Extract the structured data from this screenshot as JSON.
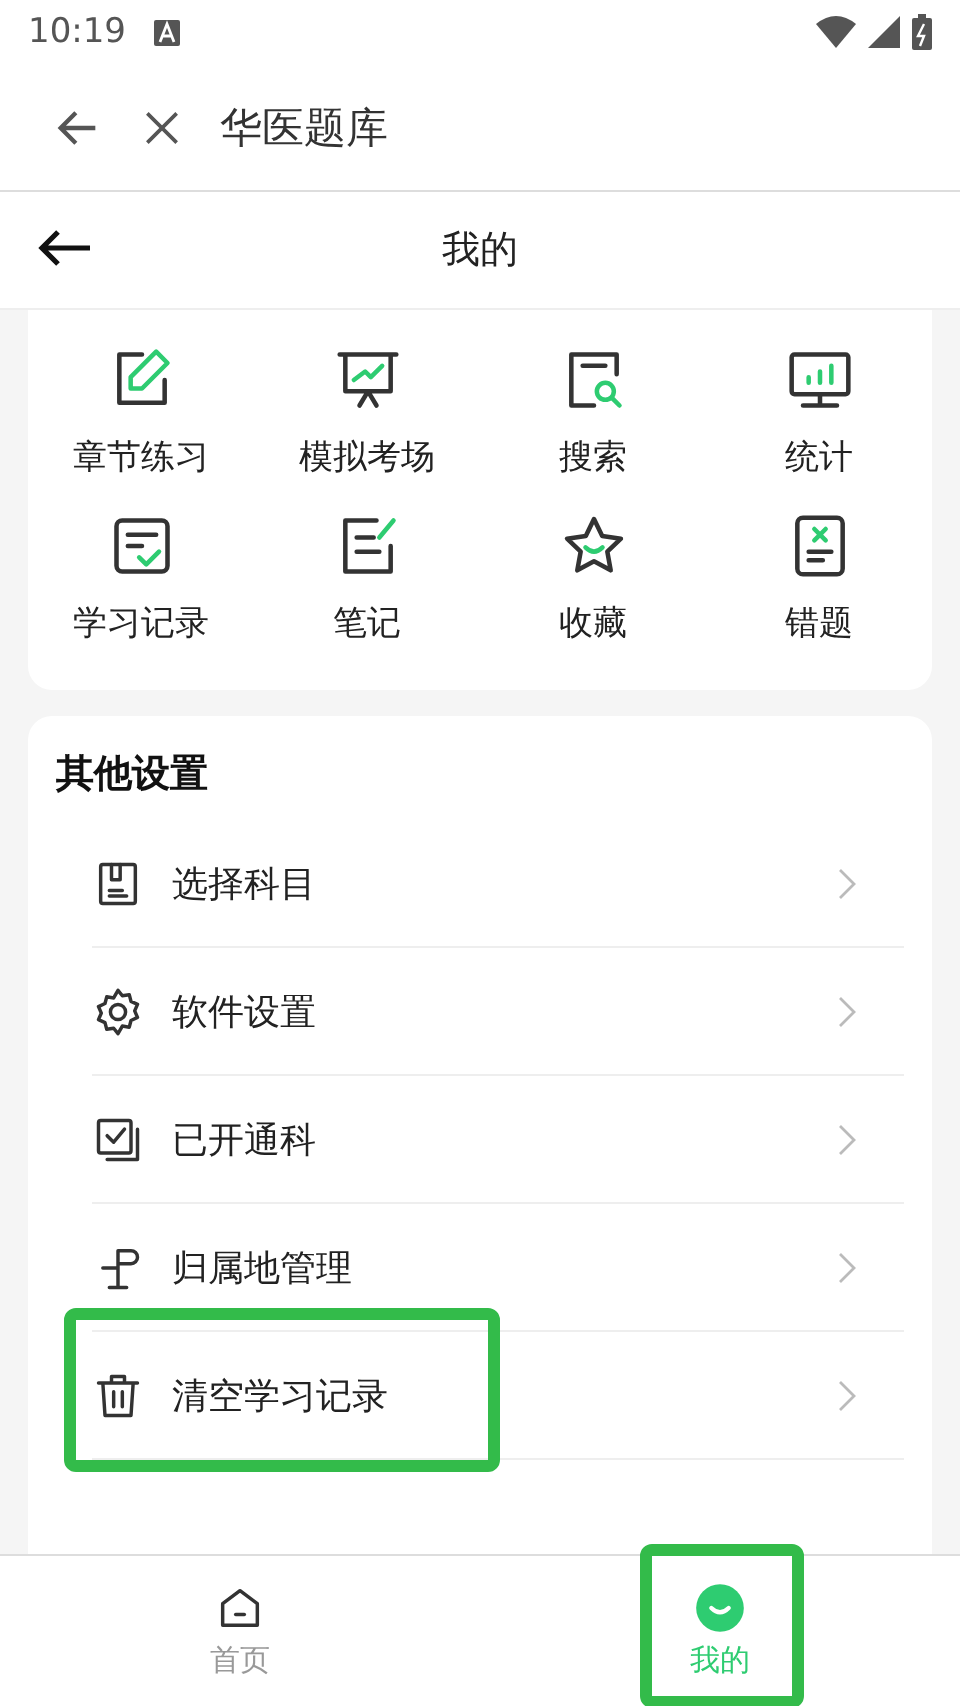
{
  "status_bar": {
    "time": "10:19"
  },
  "browser_bar": {
    "title": "华医题库"
  },
  "page_header": {
    "title": "我的"
  },
  "features": [
    {
      "label": "章节练习"
    },
    {
      "label": "模拟考场"
    },
    {
      "label": "搜索"
    },
    {
      "label": "统计"
    },
    {
      "label": "学习记录"
    },
    {
      "label": "笔记"
    },
    {
      "label": "收藏"
    },
    {
      "label": "错题"
    }
  ],
  "settings": {
    "title": "其他设置",
    "items": [
      {
        "label": "选择科目",
        "highlighted": false
      },
      {
        "label": "软件设置",
        "highlighted": false
      },
      {
        "label": "已开通科",
        "highlighted": false
      },
      {
        "label": "归属地管理",
        "highlighted": false
      },
      {
        "label": "清空学习记录",
        "highlighted": true
      }
    ]
  },
  "tabs": [
    {
      "label": "首页",
      "selected": false,
      "highlighted": false
    },
    {
      "label": "我的",
      "selected": true,
      "highlighted": true
    }
  ]
}
